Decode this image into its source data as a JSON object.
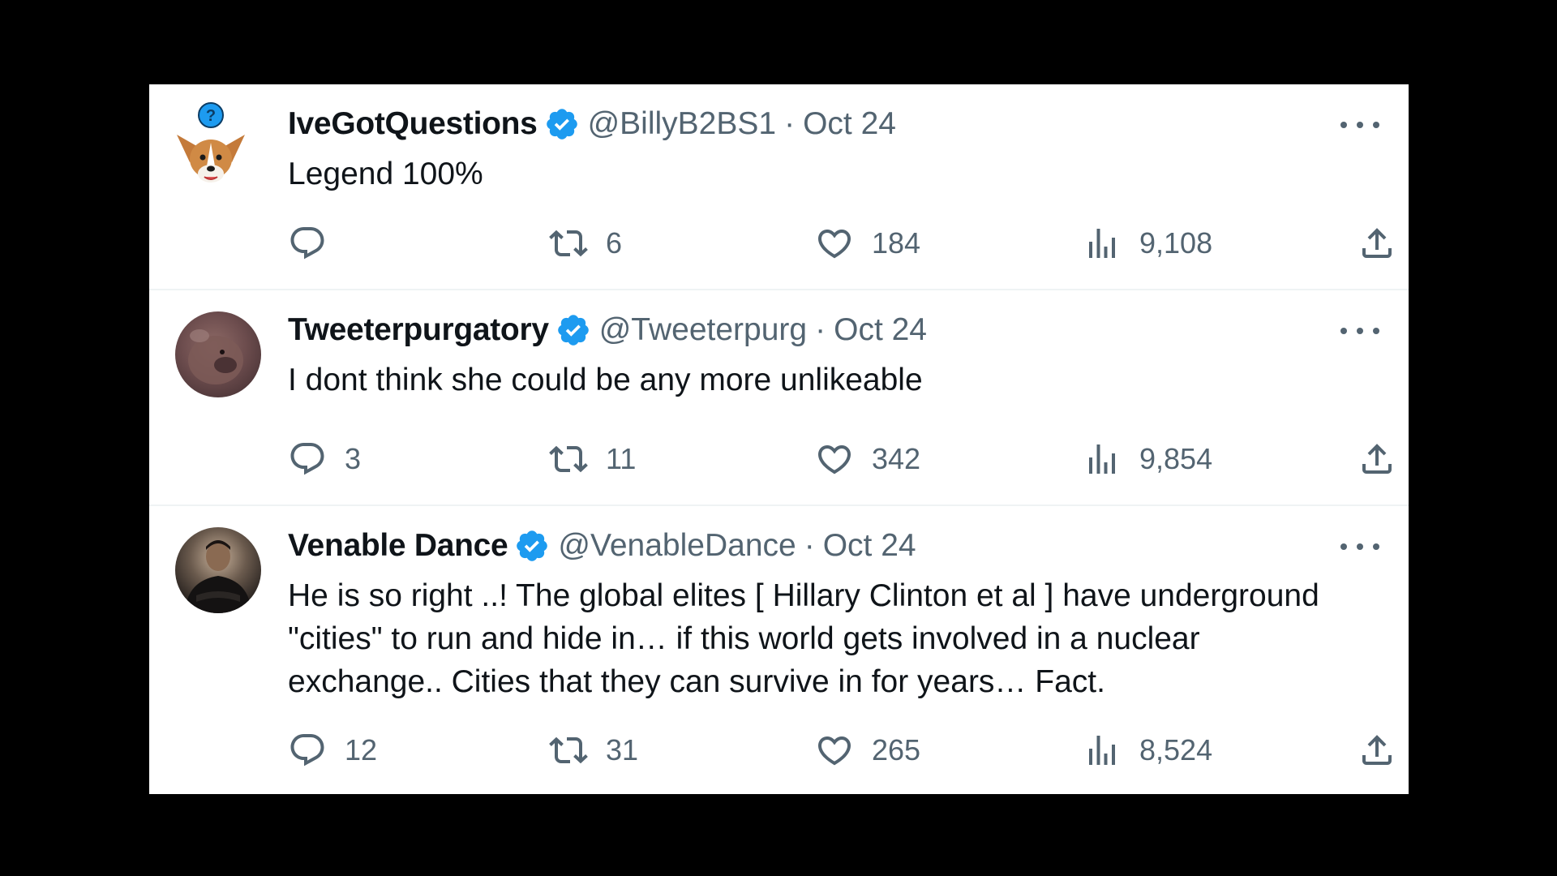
{
  "tweets": [
    {
      "name": "IveGotQuestions",
      "handle": "@BillyB2BS1",
      "date": "Oct 24",
      "text": "Legend 100%",
      "replies": "",
      "retweets": "6",
      "likes": "184",
      "views": "9,108"
    },
    {
      "name": "Tweeterpurgatory",
      "handle": "@Tweeterpurg",
      "date": "Oct 24",
      "text": "I dont think she could be any more unlikeable",
      "replies": "3",
      "retweets": "11",
      "likes": "342",
      "views": "9,854"
    },
    {
      "name": "Venable Dance",
      "handle": "@VenableDance",
      "date": "Oct 24",
      "text": "He is so right ..! The global elites [ Hillary Clinton et al  ] have underground\n\"cities\" to run and hide in… if this world gets involved in a nuclear\nexchange.. Cities that they can survive in for years… Fact.",
      "replies": "12",
      "retweets": "31",
      "likes": "265",
      "views": "8,524"
    }
  ],
  "separator": "·",
  "colors": {
    "verified": "#1d9bf0",
    "muted": "#536471",
    "text": "#0f1419"
  }
}
